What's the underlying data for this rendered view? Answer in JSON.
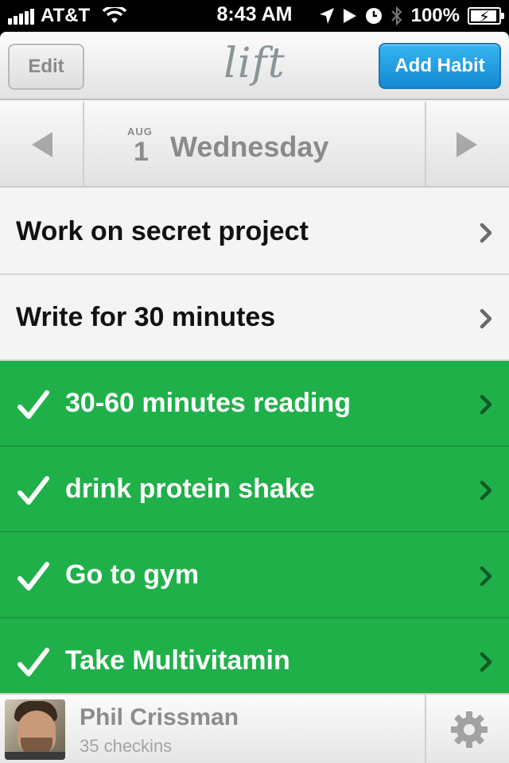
{
  "status_bar": {
    "carrier": "AT&T",
    "time": "8:43 AM",
    "battery_percent": "100%",
    "icons": [
      "signal-icon",
      "wifi-icon",
      "location-icon",
      "play-icon",
      "alarm-icon",
      "bluetooth-icon",
      "battery-charging-icon"
    ]
  },
  "navbar": {
    "edit_label": "Edit",
    "logo_text": "lift",
    "add_label": "Add Habit"
  },
  "date": {
    "month": "AUG",
    "day": "1",
    "weekday": "Wednesday"
  },
  "habits": [
    {
      "label": "Work on secret project",
      "done": false
    },
    {
      "label": "Write for 30 minutes",
      "done": false
    },
    {
      "label": "30-60 minutes reading",
      "done": true
    },
    {
      "label": "drink protein shake",
      "done": true
    },
    {
      "label": "Go to gym",
      "done": true
    },
    {
      "label": "Take Multivitamin",
      "done": true
    }
  ],
  "footer": {
    "user_name": "Phil Crissman",
    "checkins": "35 checkins"
  },
  "colors": {
    "done_green": "#20b04a",
    "accent_blue": "#1b8fd8"
  }
}
